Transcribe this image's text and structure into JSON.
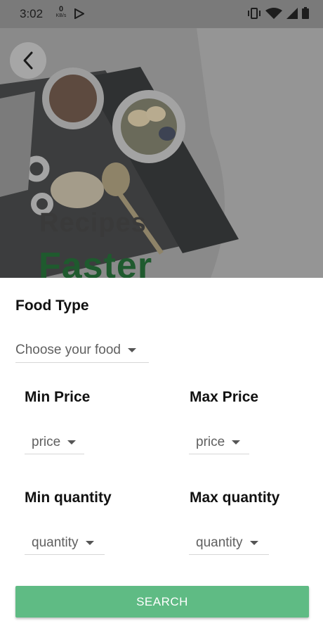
{
  "status_bar": {
    "time": "3:02",
    "net_speed": "0",
    "net_unit": "KB/s"
  },
  "hero": {
    "title": "Recipes",
    "subtitle": "Faster"
  },
  "form": {
    "food_type_label": "Food Type",
    "food_type_value": "Choose your food",
    "min_price_label": "Min Price",
    "min_price_value": "price",
    "max_price_label": "Max Price",
    "max_price_value": "price",
    "min_quantity_label": "Min quantity",
    "min_quantity_value": "quantity",
    "max_quantity_label": "Max quantity",
    "max_quantity_value": "quantity"
  },
  "search_button": {
    "label": "SEARCH"
  },
  "colors": {
    "accent": "#5fbb84",
    "status_bar": "#7a7a7a",
    "hero_title": "#3a3a3a",
    "hero_subtitle": "#1f5a2e"
  },
  "icons": [
    "back-arrow-icon",
    "play-store-icon",
    "vibrate-icon",
    "wifi-icon",
    "signal-icon",
    "battery-icon"
  ]
}
